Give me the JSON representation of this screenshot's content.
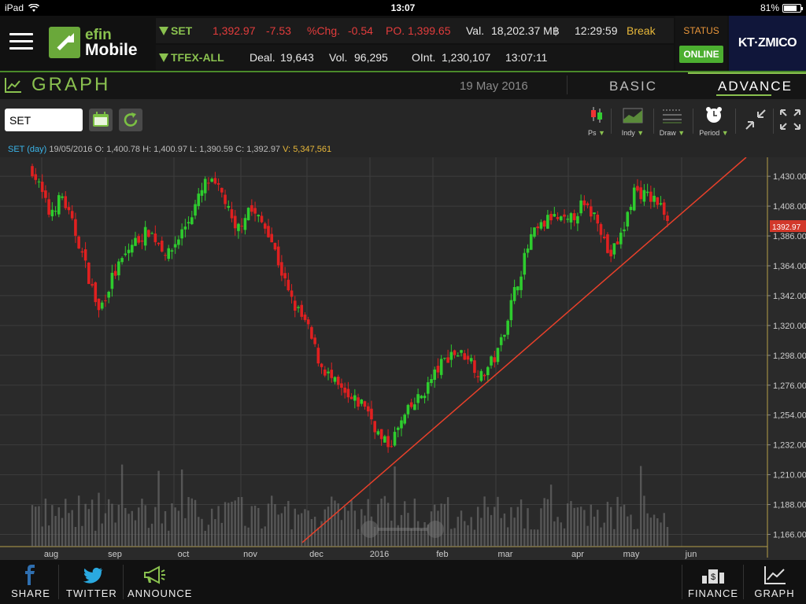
{
  "statusbar": {
    "device": "iPad",
    "time": "13:07",
    "battery": "81%",
    "battery_level": 0.81
  },
  "header": {
    "logo_line1": "efin",
    "logo_line2": "Mobile",
    "ticker1": {
      "symbol": "SET",
      "last": "1,392.97",
      "change": "-7.53",
      "pct_label": "%Chg.",
      "pct": "-0.54",
      "po_label": "PO.",
      "po": "1,399.65",
      "val_label": "Val.",
      "val": "18,202.37 M฿",
      "time": "12:29:59",
      "state": "Break"
    },
    "ticker2": {
      "symbol": "TFEX-ALL",
      "deal_label": "Deal.",
      "deal": "19,643",
      "vol_label": "Vol.",
      "vol": "96,295",
      "oint_label": "OInt.",
      "oint": "1,230,107",
      "time": "13:07:11"
    },
    "status_label": "STATUS",
    "status_value": "ONLINE",
    "broker": "KT·ZMICO"
  },
  "titlebar": {
    "title": "GRAPH",
    "date": "19 May 2016",
    "tab_basic": "BASIC",
    "tab_advance": "ADVANCE"
  },
  "toolbar": {
    "symbol_value": "SET",
    "tools": [
      {
        "name": "price-style",
        "label": "Ps"
      },
      {
        "name": "indicator",
        "label": "Indy"
      },
      {
        "name": "draw",
        "label": "Draw"
      },
      {
        "name": "period",
        "label": "Period"
      }
    ]
  },
  "info": {
    "series": "SET (day)",
    "date": "19/05/2016",
    "o_label": "O:",
    "o": "1,400.78",
    "h_label": "H:",
    "h": "1,400.97",
    "l_label": "L:",
    "l": "1,390.59",
    "c_label": "C:",
    "c": "1,392.97",
    "v_label": "V:",
    "v": "5,347,561"
  },
  "colors": {
    "up": "#2ecc2e",
    "down": "#e02020",
    "trendline": "#e8402a",
    "accent": "#8ac14f"
  },
  "chart_data": {
    "type": "candlestick",
    "title": "",
    "y_ticks": [
      "1,430.00",
      "1,408.00",
      "1,386.00",
      "1,364.00",
      "1,342.00",
      "1,320.00",
      "1,298.00",
      "1,276.00",
      "1,254.00",
      "1,232.00",
      "1,210.00",
      "1,188.00",
      "1,166.00"
    ],
    "ylim": [
      1157,
      1444
    ],
    "x_labels": [
      "aug",
      "sep",
      "oct",
      "nov",
      "dec",
      "2016",
      "feb",
      "mar",
      "apr",
      "may",
      "jun"
    ],
    "last_price_label": "1392.97",
    "close_path": [
      [
        0,
        1435
      ],
      [
        5,
        1420
      ],
      [
        10,
        1403
      ],
      [
        18,
        1415
      ],
      [
        28,
        1381
      ],
      [
        40,
        1330
      ],
      [
        48,
        1355
      ],
      [
        60,
        1380
      ],
      [
        70,
        1390
      ],
      [
        82,
        1372
      ],
      [
        95,
        1400
      ],
      [
        105,
        1427
      ],
      [
        115,
        1416
      ],
      [
        122,
        1388
      ],
      [
        130,
        1407
      ],
      [
        142,
        1390
      ],
      [
        155,
        1340
      ],
      [
        165,
        1320
      ],
      [
        173,
        1292
      ],
      [
        180,
        1280
      ],
      [
        190,
        1265
      ],
      [
        200,
        1262
      ],
      [
        210,
        1235
      ],
      [
        215,
        1232
      ],
      [
        225,
        1255
      ],
      [
        235,
        1270
      ],
      [
        245,
        1290
      ],
      [
        252,
        1300
      ],
      [
        262,
        1298
      ],
      [
        270,
        1282
      ],
      [
        280,
        1300
      ],
      [
        290,
        1345
      ],
      [
        300,
        1385
      ],
      [
        312,
        1400
      ],
      [
        322,
        1395
      ],
      [
        330,
        1408
      ],
      [
        340,
        1400
      ],
      [
        347,
        1370
      ],
      [
        355,
        1388
      ],
      [
        362,
        1420
      ],
      [
        375,
        1412
      ],
      [
        385,
        1396
      ],
      [
        395,
        1385
      ],
      [
        401,
        1391
      ]
    ],
    "trendline": {
      "from": [
        1160,
        0
      ],
      "to": [
        1444,
        353
      ]
    },
    "volume_note": "volume bars shown behind price"
  },
  "bottom": {
    "share": "SHARE",
    "twitter": "TWITTER",
    "announce": "ANNOUNCE",
    "finance": "FINANCE",
    "graph": "GRAPH"
  }
}
